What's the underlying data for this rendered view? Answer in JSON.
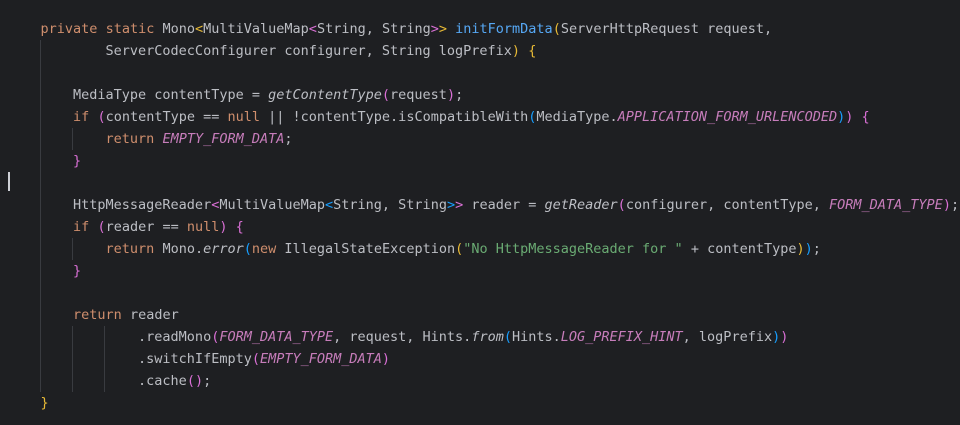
{
  "editor": {
    "language": "java",
    "theme_colors": {
      "background": "#1e1f22",
      "default_text": "#bcbec4",
      "keyword": "#cf8e6d",
      "method_declaration": "#56a8f5",
      "static_field": "#c77dbb",
      "string": "#6aab73",
      "bracket_level_1": "#e8ba36",
      "bracket_level_2": "#da70d6",
      "bracket_level_3": "#179fff",
      "indent_guide": "#393b40"
    },
    "caret_line": 8,
    "lines": [
      {
        "tokens": [
          {
            "t": "    ",
            "k": "default"
          },
          {
            "t": "private",
            "k": "kw"
          },
          {
            "t": " ",
            "k": "default"
          },
          {
            "t": "static",
            "k": "kw"
          },
          {
            "t": " Mono",
            "k": "default"
          },
          {
            "t": "<",
            "k": "br-1"
          },
          {
            "t": "MultiValueMap",
            "k": "default"
          },
          {
            "t": "<",
            "k": "br-2"
          },
          {
            "t": "String, String",
            "k": "default"
          },
          {
            "t": ">",
            "k": "br-2"
          },
          {
            "t": ">",
            "k": "br-1"
          },
          {
            "t": " ",
            "k": "default"
          },
          {
            "t": "initFormData",
            "k": "method-decl"
          },
          {
            "t": "(",
            "k": "br-1"
          },
          {
            "t": "ServerHttpRequest request,",
            "k": "default"
          }
        ]
      },
      {
        "tokens": [
          {
            "t": "            ServerCodecConfigurer configurer, String logPrefix",
            "k": "default"
          },
          {
            "t": ")",
            "k": "br-1"
          },
          {
            "t": " ",
            "k": "default"
          },
          {
            "t": "{",
            "k": "br-1"
          }
        ]
      },
      {
        "tokens": []
      },
      {
        "tokens": [
          {
            "t": "        MediaType contentType = ",
            "k": "default"
          },
          {
            "t": "getContentType",
            "k": "method-call"
          },
          {
            "t": "(",
            "k": "br-2"
          },
          {
            "t": "request",
            "k": "default"
          },
          {
            "t": ")",
            "k": "br-2"
          },
          {
            "t": ";",
            "k": "default"
          }
        ]
      },
      {
        "tokens": [
          {
            "t": "        ",
            "k": "default"
          },
          {
            "t": "if",
            "k": "kw"
          },
          {
            "t": " ",
            "k": "default"
          },
          {
            "t": "(",
            "k": "br-2"
          },
          {
            "t": "contentType == ",
            "k": "default"
          },
          {
            "t": "null",
            "k": "kw"
          },
          {
            "t": " || !contentType.isCompatibleWith",
            "k": "default"
          },
          {
            "t": "(",
            "k": "br-3"
          },
          {
            "t": "MediaType.",
            "k": "default"
          },
          {
            "t": "APPLICATION_FORM_URLENCODED",
            "k": "static-field"
          },
          {
            "t": ")",
            "k": "br-3"
          },
          {
            "t": ")",
            "k": "br-2"
          },
          {
            "t": " ",
            "k": "default"
          },
          {
            "t": "{",
            "k": "br-2"
          }
        ]
      },
      {
        "tokens": [
          {
            "t": "            ",
            "k": "default"
          },
          {
            "t": "return",
            "k": "kw"
          },
          {
            "t": " ",
            "k": "default"
          },
          {
            "t": "EMPTY_FORM_DATA",
            "k": "static-field"
          },
          {
            "t": ";",
            "k": "default"
          }
        ]
      },
      {
        "tokens": [
          {
            "t": "        ",
            "k": "default"
          },
          {
            "t": "}",
            "k": "br-2"
          }
        ]
      },
      {
        "tokens": []
      },
      {
        "tokens": [
          {
            "t": "        HttpMessageReader",
            "k": "default"
          },
          {
            "t": "<",
            "k": "br-2"
          },
          {
            "t": "MultiValueMap",
            "k": "default"
          },
          {
            "t": "<",
            "k": "br-3"
          },
          {
            "t": "String, String",
            "k": "default"
          },
          {
            "t": ">",
            "k": "br-3"
          },
          {
            "t": ">",
            "k": "br-2"
          },
          {
            "t": " reader = ",
            "k": "default"
          },
          {
            "t": "getReader",
            "k": "method-call"
          },
          {
            "t": "(",
            "k": "br-2"
          },
          {
            "t": "configurer, contentType, ",
            "k": "default"
          },
          {
            "t": "FORM_DATA_TYPE",
            "k": "static-field"
          },
          {
            "t": ")",
            "k": "br-2"
          },
          {
            "t": ";",
            "k": "default"
          }
        ]
      },
      {
        "tokens": [
          {
            "t": "        ",
            "k": "default"
          },
          {
            "t": "if",
            "k": "kw"
          },
          {
            "t": " ",
            "k": "default"
          },
          {
            "t": "(",
            "k": "br-2"
          },
          {
            "t": "reader == ",
            "k": "default"
          },
          {
            "t": "null",
            "k": "kw"
          },
          {
            "t": ")",
            "k": "br-2"
          },
          {
            "t": " ",
            "k": "default"
          },
          {
            "t": "{",
            "k": "br-2"
          }
        ]
      },
      {
        "tokens": [
          {
            "t": "            ",
            "k": "default"
          },
          {
            "t": "return",
            "k": "kw"
          },
          {
            "t": " Mono.",
            "k": "default"
          },
          {
            "t": "error",
            "k": "method-call"
          },
          {
            "t": "(",
            "k": "br-3"
          },
          {
            "t": "new",
            "k": "kw"
          },
          {
            "t": " IllegalStateException",
            "k": "default"
          },
          {
            "t": "(",
            "k": "br-1"
          },
          {
            "t": "\"No HttpMessageReader for \"",
            "k": "string"
          },
          {
            "t": " + contentType",
            "k": "default"
          },
          {
            "t": ")",
            "k": "br-1"
          },
          {
            "t": ")",
            "k": "br-3"
          },
          {
            "t": ";",
            "k": "default"
          }
        ]
      },
      {
        "tokens": [
          {
            "t": "        ",
            "k": "default"
          },
          {
            "t": "}",
            "k": "br-2"
          }
        ]
      },
      {
        "tokens": []
      },
      {
        "tokens": [
          {
            "t": "        ",
            "k": "default"
          },
          {
            "t": "return",
            "k": "kw"
          },
          {
            "t": " reader",
            "k": "default"
          }
        ]
      },
      {
        "tokens": [
          {
            "t": "                .readMono",
            "k": "default"
          },
          {
            "t": "(",
            "k": "br-2"
          },
          {
            "t": "FORM_DATA_TYPE",
            "k": "static-field"
          },
          {
            "t": ", request, Hints.",
            "k": "default"
          },
          {
            "t": "from",
            "k": "method-call"
          },
          {
            "t": "(",
            "k": "br-3"
          },
          {
            "t": "Hints.",
            "k": "default"
          },
          {
            "t": "LOG_PREFIX_HINT",
            "k": "static-field"
          },
          {
            "t": ", logPrefix",
            "k": "default"
          },
          {
            "t": ")",
            "k": "br-3"
          },
          {
            "t": ")",
            "k": "br-2"
          }
        ]
      },
      {
        "tokens": [
          {
            "t": "                .switchIfEmpty",
            "k": "default"
          },
          {
            "t": "(",
            "k": "br-2"
          },
          {
            "t": "EMPTY_FORM_DATA",
            "k": "static-field"
          },
          {
            "t": ")",
            "k": "br-2"
          }
        ]
      },
      {
        "tokens": [
          {
            "t": "                .cache",
            "k": "default"
          },
          {
            "t": "(",
            "k": "br-2"
          },
          {
            "t": ")",
            "k": "br-2"
          },
          {
            "t": ";",
            "k": "default"
          }
        ]
      },
      {
        "tokens": [
          {
            "t": "    ",
            "k": "default"
          },
          {
            "t": "}",
            "k": "br-1"
          }
        ]
      }
    ]
  }
}
